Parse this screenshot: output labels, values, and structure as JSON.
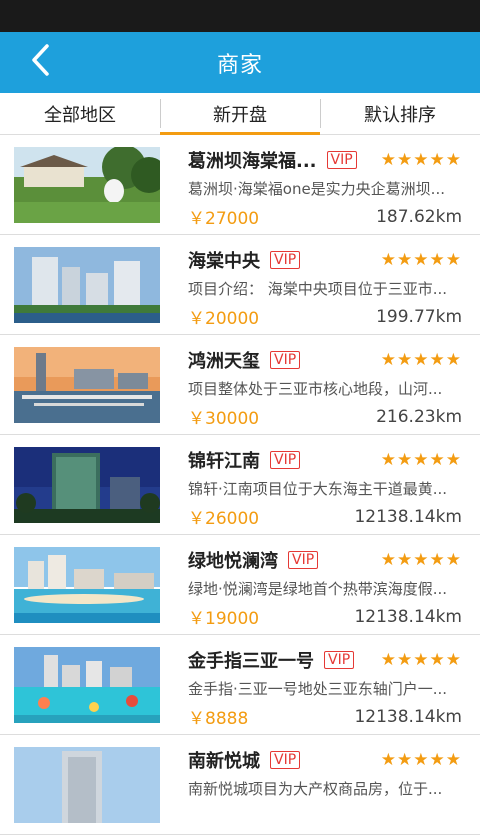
{
  "header": {
    "title": "商家",
    "back_icon": "chevron-left-icon"
  },
  "tabs": [
    {
      "label": "全部地区",
      "active": false
    },
    {
      "label": "新开盘",
      "active": true
    },
    {
      "label": "默认排序",
      "active": false
    }
  ],
  "colors": {
    "accent": "#1ea0dc",
    "highlight": "#f39c12",
    "vip": "#e53935"
  },
  "listings": [
    {
      "name": "葛洲坝海棠福...",
      "vip": "VIP",
      "stars": "★★★★★",
      "rating": 5,
      "desc": "葛洲坝·海棠福one是实力央企葛洲坝...",
      "price": "￥27000",
      "distance": "187.62km"
    },
    {
      "name": "海棠中央",
      "vip": "VIP",
      "stars": "★★★★★",
      "rating": 5,
      "desc": "项目介绍： 海棠中央项目位于三亚市...",
      "price": "￥20000",
      "distance": "199.77km"
    },
    {
      "name": "鸿洲天玺",
      "vip": "VIP",
      "stars": "★★★★★",
      "rating": 5,
      "desc": "项目整体处于三亚市核心地段，山河...",
      "price": "￥30000",
      "distance": "216.23km"
    },
    {
      "name": "锦轩江南",
      "vip": "VIP",
      "stars": "★★★★★",
      "rating": 5,
      "desc": "锦轩·江南项目位于大东海主干道最黄...",
      "price": "￥26000",
      "distance": "12138.14km"
    },
    {
      "name": "绿地悦澜湾",
      "vip": "VIP",
      "stars": "★★★★★",
      "rating": 5,
      "desc": "绿地·悦澜湾是绿地首个热带滨海度假...",
      "price": "￥19000",
      "distance": "12138.14km"
    },
    {
      "name": "金手指三亚一号",
      "vip": "VIP",
      "stars": "★★★★★",
      "rating": 5,
      "desc": "金手指·三亚一号地处三亚东轴门户一...",
      "price": "￥8888",
      "distance": "12138.14km"
    },
    {
      "name": "南新悦城",
      "vip": "VIP",
      "stars": "★★★★★",
      "rating": 5,
      "desc": "南新悦城项目为大产权商品房，位于...",
      "price": "",
      "distance": ""
    }
  ]
}
